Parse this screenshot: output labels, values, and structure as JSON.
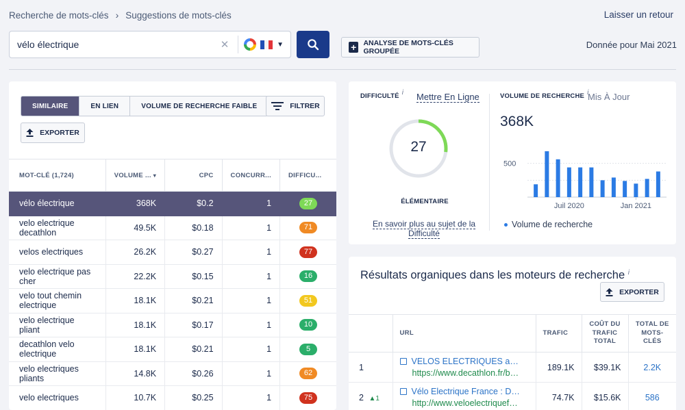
{
  "breadcrumb": {
    "items": [
      "Recherche de mots-clés",
      "Suggestions de mots-clés"
    ],
    "separator": "›"
  },
  "header": {
    "feedback": "Laisser un retour",
    "data_date": "Donnée pour Mai 2021"
  },
  "search": {
    "query": "vélo électrique",
    "clear_icon": "close-icon",
    "engine_icon": "google-icon",
    "country": "France",
    "flag_colors": [
      "#1f4fb5",
      "#ffffff",
      "#e2353a"
    ]
  },
  "bulk_button": {
    "label": "ANALYSE DE MOTS-CLÉS GROUPÉE"
  },
  "keywords": {
    "tabs": [
      {
        "label": "SIMILAIRE",
        "active": true
      },
      {
        "label": "EN LIEN",
        "active": false
      },
      {
        "label": "VOLUME DE RECHERCHE FAIBLE",
        "active": false
      }
    ],
    "filter_label": "FILTRER",
    "export_label": "EXPORTER",
    "columns": [
      "MOT-CLÉ (1,724)",
      "VOLUME ...",
      "CPC",
      "CONCURR...",
      "DIFFICU..."
    ],
    "rows": [
      {
        "keyword": "vélo électrique",
        "volume": "368K",
        "cpc": "$0.2",
        "competition": "1",
        "difficulty": "27",
        "color": "#7ed957",
        "selected": true
      },
      {
        "keyword": "velo electrique decathlon",
        "volume": "49.5K",
        "cpc": "$0.18",
        "competition": "1",
        "difficulty": "71",
        "color": "#f08a24"
      },
      {
        "keyword": "velos electriques",
        "volume": "26.2K",
        "cpc": "$0.27",
        "competition": "1",
        "difficulty": "77",
        "color": "#d0321e"
      },
      {
        "keyword": "velo electrique pas cher",
        "volume": "22.2K",
        "cpc": "$0.15",
        "competition": "1",
        "difficulty": "16",
        "color": "#2bae6a"
      },
      {
        "keyword": "velo tout chemin electrique",
        "volume": "18.1K",
        "cpc": "$0.21",
        "competition": "1",
        "difficulty": "51",
        "color": "#f2c81f"
      },
      {
        "keyword": "velo electrique pliant",
        "volume": "18.1K",
        "cpc": "$0.17",
        "competition": "1",
        "difficulty": "10",
        "color": "#2bae6a"
      },
      {
        "keyword": "decathlon velo electrique",
        "volume": "18.1K",
        "cpc": "$0.21",
        "competition": "1",
        "difficulty": "5",
        "color": "#2bae6a"
      },
      {
        "keyword": "velo electriques pliants",
        "volume": "14.8K",
        "cpc": "$0.26",
        "competition": "1",
        "difficulty": "62",
        "color": "#f08a24"
      },
      {
        "keyword": "velo electriques",
        "volume": "10.7K",
        "cpc": "$0.25",
        "competition": "1",
        "difficulty": "75",
        "color": "#d0321e"
      }
    ]
  },
  "difficulty": {
    "label": "DIFFICULTÉ",
    "info": "i",
    "update_link": "Mettre En Ligne",
    "value": "27",
    "level_fraction": 0.27,
    "level": "ÉLÉMENTAIRE",
    "learn_more": "En savoir plus au sujet de la Difficulté",
    "gauge_color": "#7ed957"
  },
  "volume": {
    "label": "VOLUME DE RECHERCHE",
    "info": "i",
    "update_text": "Mis À Jour",
    "value": "368K",
    "legend": "Volume de recherche"
  },
  "chart_data": {
    "type": "bar",
    "categories": [
      "",
      "",
      "",
      "",
      "",
      "",
      "",
      "",
      "",
      "",
      "",
      "",
      "",
      "",
      "",
      ""
    ],
    "values": [
      190,
      680,
      560,
      440,
      440,
      440,
      250,
      290,
      240,
      200,
      270,
      380
    ],
    "x_tick_labels": [
      "Juil 2020",
      "Jan 2021"
    ],
    "y_tick_label": "500",
    "ylim": [
      0,
      750
    ],
    "color": "#2b7be4",
    "grid": "horizontal dotted"
  },
  "organic": {
    "title": "Résultats organiques dans les moteurs de recherche",
    "info": "i",
    "export_label": "EXPORTER",
    "columns": [
      "",
      "URL",
      "TRAFIC",
      "COÛT DU TRAFIC TOTAL",
      "TOTAL DE MOTS-CLÉS"
    ],
    "rows": [
      {
        "rank": "1",
        "change": "",
        "title": "VELOS ELECTRIQUES au meilleur prix",
        "url": "https://www.decathlon.fr/browse/velos-electriques",
        "traffic": "189.1K",
        "cost": "$39.1K",
        "keywords": "2.2K"
      },
      {
        "rank": "2",
        "change": "▲1",
        "title": "Vélo Electrique France : Des experts",
        "url": "http://www.veloelectriquefrance.fr",
        "traffic": "74.7K",
        "cost": "$15.6K",
        "keywords": "586"
      }
    ]
  }
}
